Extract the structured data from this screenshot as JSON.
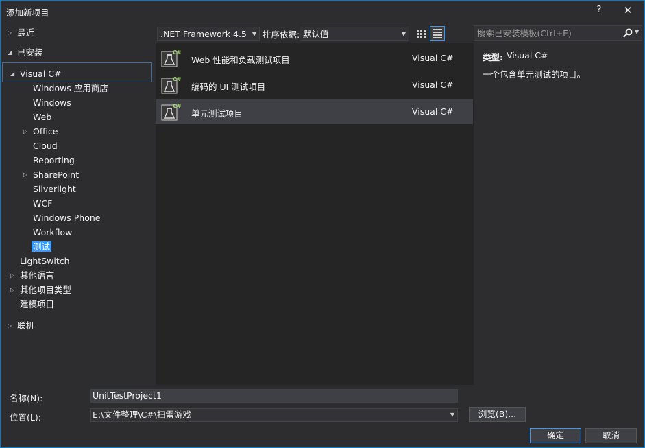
{
  "window": {
    "title": "添加新项目",
    "help_label": "?",
    "close_label": "✕"
  },
  "tree": {
    "recent": "最近",
    "installed": "已安装",
    "visual_csharp": "Visual C#",
    "children": [
      "Windows 应用商店",
      "Windows",
      "Web",
      "Office",
      "Cloud",
      "Reporting",
      "SharePoint",
      "Silverlight",
      "WCF",
      "Windows Phone",
      "Workflow",
      "测试"
    ],
    "lightswitch": "LightSwitch",
    "other_languages": "其他语言",
    "other_project_types": "其他项目类型",
    "modeling": "建模项目",
    "online": "联机"
  },
  "toolbar": {
    "framework": ".NET Framework 4.5",
    "sort_label": "排序依据:",
    "sort_value": "默认值"
  },
  "templates": [
    {
      "name": "Web 性能和负载测试项目",
      "language": "Visual C#"
    },
    {
      "name": "编码的 UI 测试项目",
      "language": "Visual C#"
    },
    {
      "name": "单元测试项目",
      "language": "Visual C#"
    }
  ],
  "search": {
    "placeholder": "搜索已安装模板(Ctrl+E)"
  },
  "details": {
    "type_label": "类型:",
    "type_value": "Visual C#",
    "description": "一个包含单元测试的项目。"
  },
  "form": {
    "name_label": "名称(N):",
    "name_value": "UnitTestProject1",
    "location_label": "位置(L):",
    "location_value": "E:\\文件整理\\C#\\扫雷游戏",
    "browse_label": "浏览(B)...",
    "ok_label": "确定",
    "cancel_label": "取消"
  },
  "colors": {
    "accent": "#007acc",
    "selection": "#3399ff",
    "background": "#2d2d30",
    "list_background": "#252526"
  },
  "icons": {
    "template": "csharp-test-flask-icon",
    "search": "search-icon",
    "grid_view": "small-icons-view-icon",
    "list_view": "list-view-icon"
  }
}
